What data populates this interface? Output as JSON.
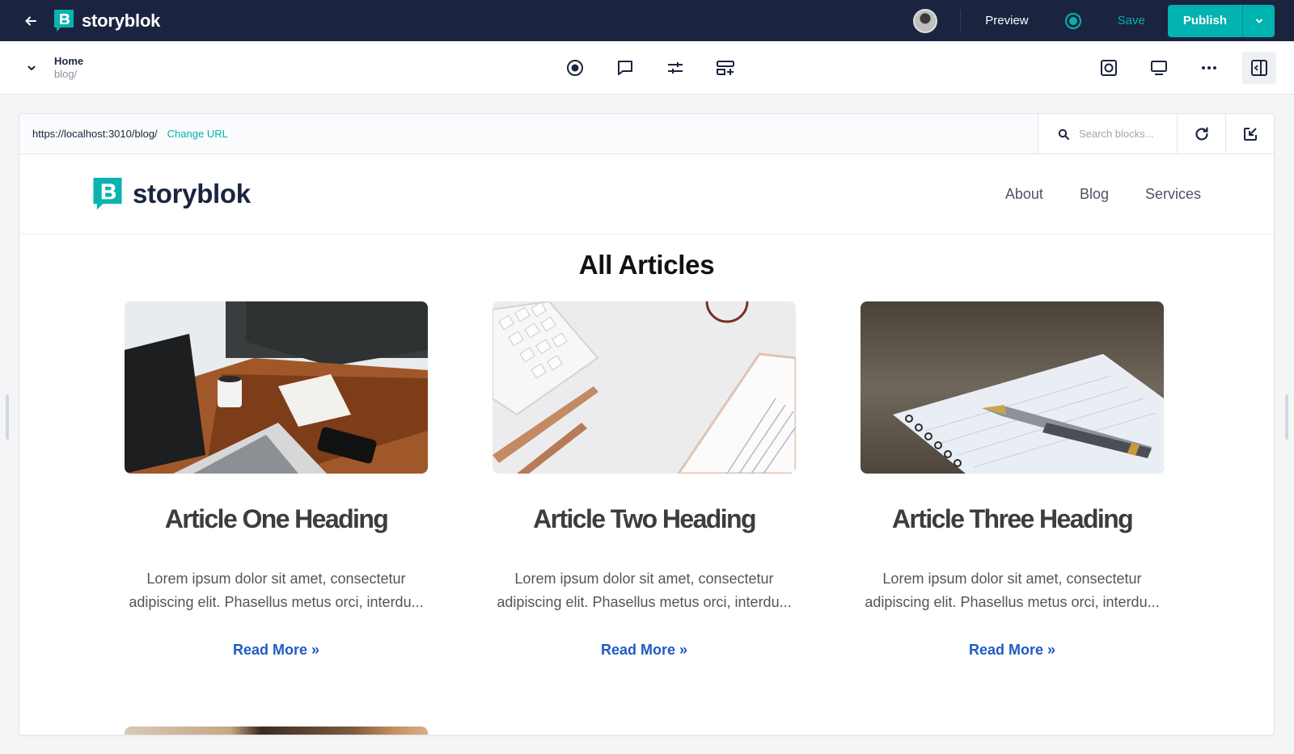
{
  "app": {
    "brand": "storyblok"
  },
  "topbar": {
    "preview_label": "Preview",
    "save_label": "Save",
    "publish_label": "Publish"
  },
  "story": {
    "name": "Home",
    "slug": "blog/"
  },
  "preview": {
    "url": "https://localhost:3010/blog/",
    "change_url_label": "Change URL",
    "search_placeholder": "Search blocks..."
  },
  "site": {
    "logo_text": "storyblok",
    "nav": [
      "About",
      "Blog",
      "Services"
    ],
    "page_title": "All Articles",
    "articles": [
      {
        "title": "Article One Heading",
        "teaser": "Lorem ipsum dolor sit amet, consectetur adipiscing elit. Phasellus metus orci, interdu...",
        "link": "Read More »"
      },
      {
        "title": "Article Two Heading",
        "teaser": "Lorem ipsum dolor sit amet, consectetur adipiscing elit. Phasellus metus orci, interdu...",
        "link": "Read More »"
      },
      {
        "title": "Article Three Heading",
        "teaser": "Lorem ipsum dolor sit amet, consectetur adipiscing elit. Phasellus metus orci, interdu...",
        "link": "Read More »"
      }
    ]
  },
  "icons": {
    "back": "arrow-left-icon",
    "status": "status-dot-icon",
    "caret": "chevron-down-icon",
    "visual_editor": "target-icon",
    "comments": "comment-icon",
    "config": "sliders-icon",
    "blocks": "add-block-icon",
    "screenshot": "screenshot-icon",
    "device": "monitor-icon",
    "more": "more-icon",
    "sidebar": "sidebar-toggle-icon",
    "search": "search-icon",
    "reload": "reload-icon",
    "open_external": "open-external-icon"
  },
  "colors": {
    "topbar_bg": "#1b243f",
    "accent": "#00b3b0",
    "link": "#1e5bc6"
  }
}
